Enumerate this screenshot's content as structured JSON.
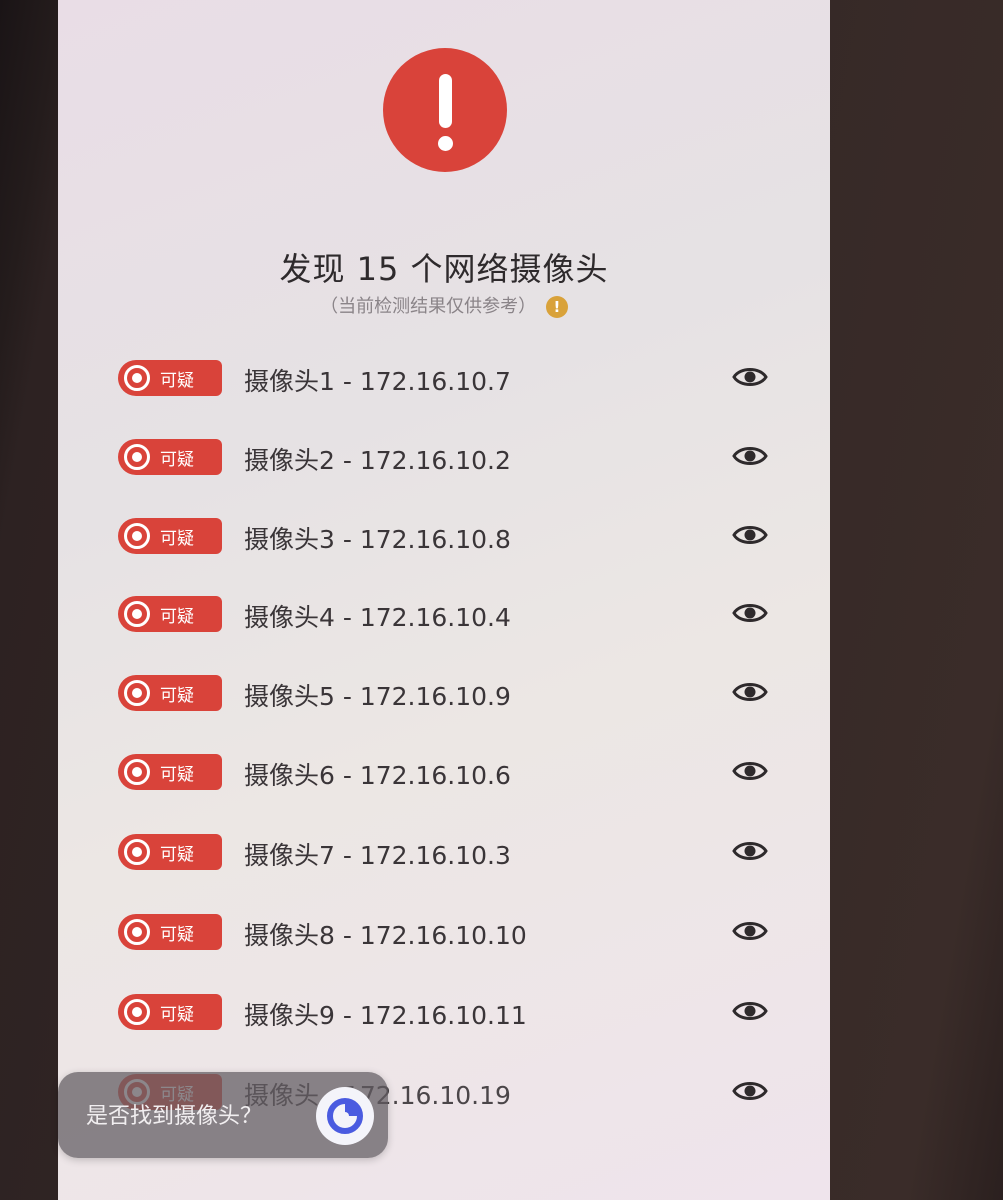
{
  "header": {
    "title": "发现 15 个网络摄像头",
    "subtitle": "（当前检测结果仅供参考）",
    "alert_icon": "exclamation-icon",
    "info_icon": "info-icon"
  },
  "tag_label": "可疑",
  "cameras": [
    {
      "label": "摄像头1 - 172.16.10.7"
    },
    {
      "label": "摄像头2 - 172.16.10.2"
    },
    {
      "label": "摄像头3 - 172.16.10.8"
    },
    {
      "label": "摄像头4 - 172.16.10.4"
    },
    {
      "label": "摄像头5 - 172.16.10.9"
    },
    {
      "label": "摄像头6 - 172.16.10.6"
    },
    {
      "label": "摄像头7 - 172.16.10.3"
    },
    {
      "label": "摄像头8 - 172.16.10.10"
    },
    {
      "label": "摄像头9 - 172.16.10.11"
    },
    {
      "label": "摄像头 - 172.16.10.19"
    }
  ],
  "helper": {
    "text": "是否找到摄像头？"
  },
  "colors": {
    "accent_red": "#d9433a",
    "info_yellow": "#d9a23a"
  }
}
